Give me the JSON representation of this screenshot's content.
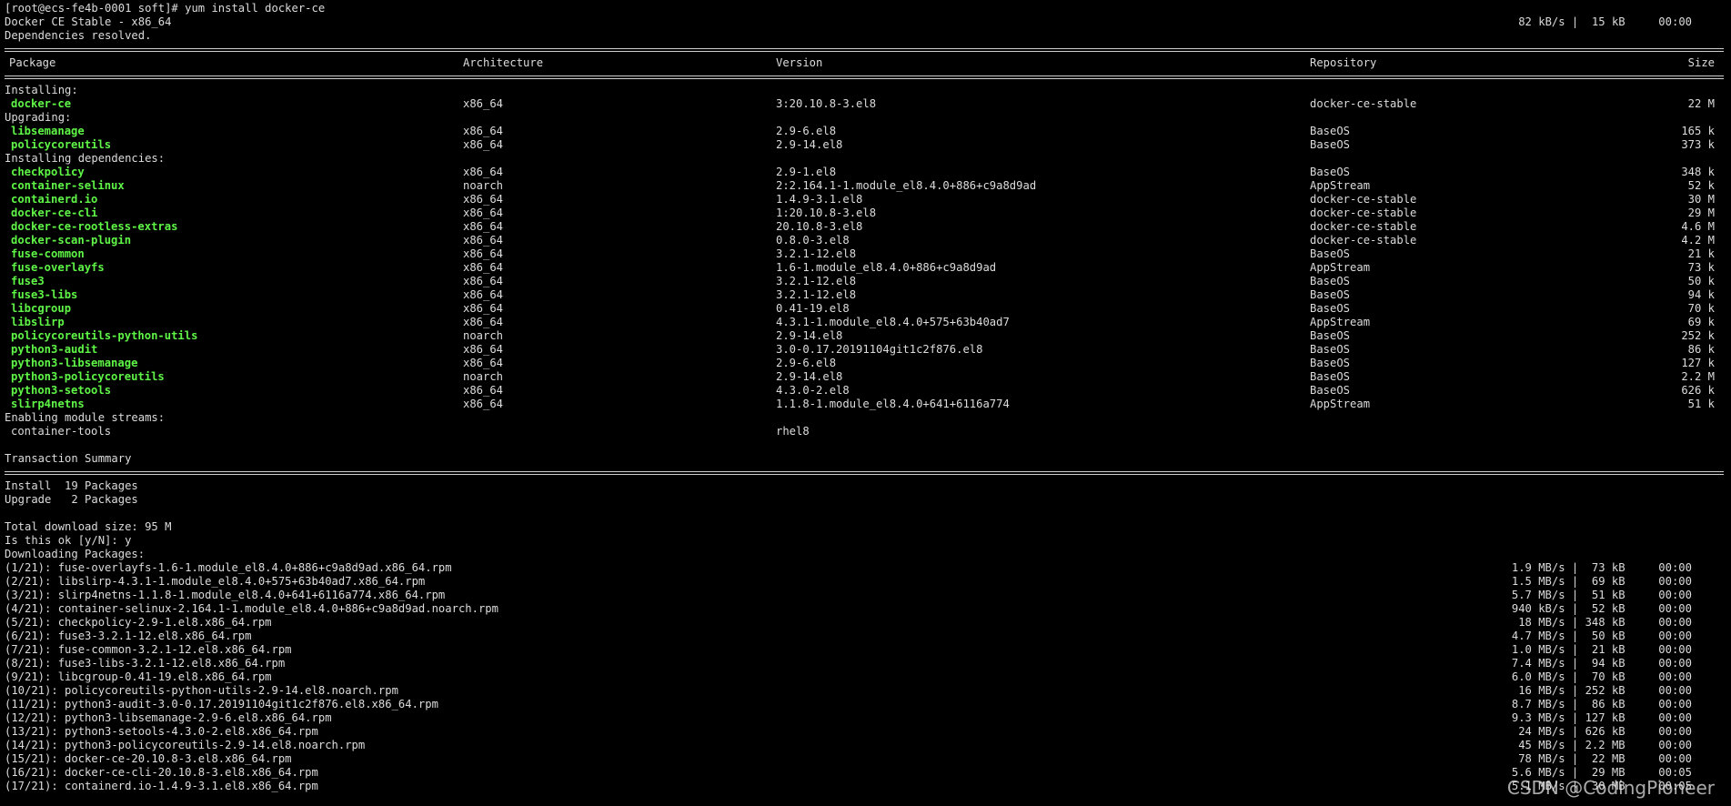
{
  "terminal": {
    "prompt": "[root@ecs-fe4b-0001 soft]# yum install docker-ce",
    "repo_line": {
      "name": "Docker CE Stable - x86_64",
      "stats": "82 kB/s |  15 kB     00:00"
    },
    "deps_resolved": "Dependencies resolved.",
    "headers": {
      "package": "Package",
      "arch": "Architecture",
      "version": "Version",
      "repo": "Repository",
      "size": "Size"
    },
    "sections": [
      {
        "title": "Installing:",
        "packages": [
          {
            "name": "docker-ce",
            "arch": "x86_64",
            "version": "3:20.10.8-3.el8",
            "repo": "docker-ce-stable",
            "size": "22 M"
          }
        ]
      },
      {
        "title": "Upgrading:",
        "packages": [
          {
            "name": "libsemanage",
            "arch": "x86_64",
            "version": "2.9-6.el8",
            "repo": "BaseOS",
            "size": "165 k"
          },
          {
            "name": "policycoreutils",
            "arch": "x86_64",
            "version": "2.9-14.el8",
            "repo": "BaseOS",
            "size": "373 k"
          }
        ]
      },
      {
        "title": "Installing dependencies:",
        "packages": [
          {
            "name": "checkpolicy",
            "arch": "x86_64",
            "version": "2.9-1.el8",
            "repo": "BaseOS",
            "size": "348 k"
          },
          {
            "name": "container-selinux",
            "arch": "noarch",
            "version": "2:2.164.1-1.module_el8.4.0+886+c9a8d9ad",
            "repo": "AppStream",
            "size": "52 k"
          },
          {
            "name": "containerd.io",
            "arch": "x86_64",
            "version": "1.4.9-3.1.el8",
            "repo": "docker-ce-stable",
            "size": "30 M"
          },
          {
            "name": "docker-ce-cli",
            "arch": "x86_64",
            "version": "1:20.10.8-3.el8",
            "repo": "docker-ce-stable",
            "size": "29 M"
          },
          {
            "name": "docker-ce-rootless-extras",
            "arch": "x86_64",
            "version": "20.10.8-3.el8",
            "repo": "docker-ce-stable",
            "size": "4.6 M"
          },
          {
            "name": "docker-scan-plugin",
            "arch": "x86_64",
            "version": "0.8.0-3.el8",
            "repo": "docker-ce-stable",
            "size": "4.2 M"
          },
          {
            "name": "fuse-common",
            "arch": "x86_64",
            "version": "3.2.1-12.el8",
            "repo": "BaseOS",
            "size": "21 k"
          },
          {
            "name": "fuse-overlayfs",
            "arch": "x86_64",
            "version": "1.6-1.module_el8.4.0+886+c9a8d9ad",
            "repo": "AppStream",
            "size": "73 k"
          },
          {
            "name": "fuse3",
            "arch": "x86_64",
            "version": "3.2.1-12.el8",
            "repo": "BaseOS",
            "size": "50 k"
          },
          {
            "name": "fuse3-libs",
            "arch": "x86_64",
            "version": "3.2.1-12.el8",
            "repo": "BaseOS",
            "size": "94 k"
          },
          {
            "name": "libcgroup",
            "arch": "x86_64",
            "version": "0.41-19.el8",
            "repo": "BaseOS",
            "size": "70 k"
          },
          {
            "name": "libslirp",
            "arch": "x86_64",
            "version": "4.3.1-1.module_el8.4.0+575+63b40ad7",
            "repo": "AppStream",
            "size": "69 k"
          },
          {
            "name": "policycoreutils-python-utils",
            "arch": "noarch",
            "version": "2.9-14.el8",
            "repo": "BaseOS",
            "size": "252 k"
          },
          {
            "name": "python3-audit",
            "arch": "x86_64",
            "version": "3.0-0.17.20191104git1c2f876.el8",
            "repo": "BaseOS",
            "size": "86 k"
          },
          {
            "name": "python3-libsemanage",
            "arch": "x86_64",
            "version": "2.9-6.el8",
            "repo": "BaseOS",
            "size": "127 k"
          },
          {
            "name": "python3-policycoreutils",
            "arch": "noarch",
            "version": "2.9-14.el8",
            "repo": "BaseOS",
            "size": "2.2 M"
          },
          {
            "name": "python3-setools",
            "arch": "x86_64",
            "version": "4.3.0-2.el8",
            "repo": "BaseOS",
            "size": "626 k"
          },
          {
            "name": "slirp4netns",
            "arch": "x86_64",
            "version": "1.1.8-1.module_el8.4.0+641+6116a774",
            "repo": "AppStream",
            "size": "51 k"
          }
        ]
      }
    ],
    "module_streams": {
      "title": "Enabling module streams:",
      "name": "container-tools",
      "stream": "rhel8"
    },
    "summary_title": "Transaction Summary",
    "summary_lines": [
      "Install  19 Packages",
      "Upgrade   2 Packages"
    ],
    "total_download": "Total download size: 95 M",
    "confirm": "Is this ok [y/N]: y",
    "downloading": "Downloading Packages:",
    "downloads": [
      {
        "file": "(1/21): fuse-overlayfs-1.6-1.module_el8.4.0+886+c9a8d9ad.x86_64.rpm",
        "stats": "1.9 MB/s |  73 kB     00:00"
      },
      {
        "file": "(2/21): libslirp-4.3.1-1.module_el8.4.0+575+63b40ad7.x86_64.rpm",
        "stats": "1.5 MB/s |  69 kB     00:00"
      },
      {
        "file": "(3/21): slirp4netns-1.1.8-1.module_el8.4.0+641+6116a774.x86_64.rpm",
        "stats": "5.7 MB/s |  51 kB     00:00"
      },
      {
        "file": "(4/21): container-selinux-2.164.1-1.module_el8.4.0+886+c9a8d9ad.noarch.rpm",
        "stats": "940 kB/s |  52 kB     00:00"
      },
      {
        "file": "(5/21): checkpolicy-2.9-1.el8.x86_64.rpm",
        "stats": "18 MB/s | 348 kB     00:00"
      },
      {
        "file": "(6/21): fuse3-3.2.1-12.el8.x86_64.rpm",
        "stats": "4.7 MB/s |  50 kB     00:00"
      },
      {
        "file": "(7/21): fuse-common-3.2.1-12.el8.x86_64.rpm",
        "stats": "1.0 MB/s |  21 kB     00:00"
      },
      {
        "file": "(8/21): fuse3-libs-3.2.1-12.el8.x86_64.rpm",
        "stats": "7.4 MB/s |  94 kB     00:00"
      },
      {
        "file": "(9/21): libcgroup-0.41-19.el8.x86_64.rpm",
        "stats": "6.0 MB/s |  70 kB     00:00"
      },
      {
        "file": "(10/21): policycoreutils-python-utils-2.9-14.el8.noarch.rpm",
        "stats": "16 MB/s | 252 kB     00:00"
      },
      {
        "file": "(11/21): python3-audit-3.0-0.17.20191104git1c2f876.el8.x86_64.rpm",
        "stats": "8.7 MB/s |  86 kB     00:00"
      },
      {
        "file": "(12/21): python3-libsemanage-2.9-6.el8.x86_64.rpm",
        "stats": "9.3 MB/s | 127 kB     00:00"
      },
      {
        "file": "(13/21): python3-setools-4.3.0-2.el8.x86_64.rpm",
        "stats": "24 MB/s | 626 kB     00:00"
      },
      {
        "file": "(14/21): python3-policycoreutils-2.9-14.el8.noarch.rpm",
        "stats": "45 MB/s | 2.2 MB     00:00"
      },
      {
        "file": "(15/21): docker-ce-20.10.8-3.el8.x86_64.rpm",
        "stats": "78 MB/s |  22 MB     00:00"
      },
      {
        "file": "(16/21): docker-ce-cli-20.10.8-3.el8.x86_64.rpm",
        "stats": "5.6 MB/s |  29 MB     00:05"
      },
      {
        "file": "(17/21): containerd.io-1.4.9-3.1.el8.x86_64.rpm",
        "stats": "5.1 MB/s |  30 MB     00:05"
      }
    ]
  },
  "watermark": "CSDN @CodingPioneer",
  "colors": {
    "background": "#000000",
    "text": "#dcdcdc",
    "package_name": "#5ff547"
  }
}
